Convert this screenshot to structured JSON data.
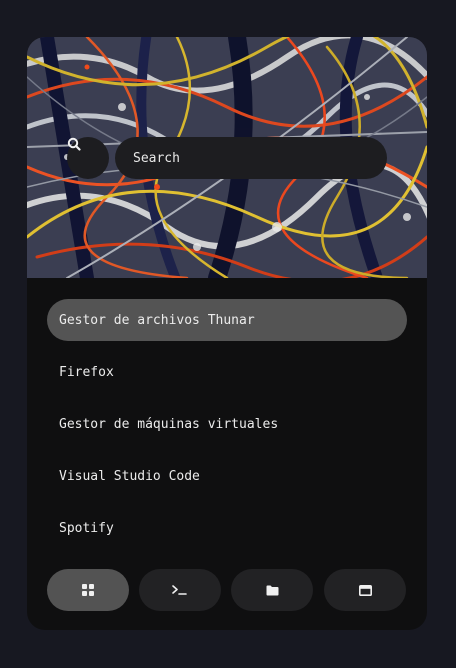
{
  "search": {
    "placeholder": "Search",
    "icon": "search-icon"
  },
  "apps": [
    {
      "label": "Gestor de archivos Thunar",
      "selected": true
    },
    {
      "label": "Firefox",
      "selected": false
    },
    {
      "label": "Gestor de máquinas virtuales",
      "selected": false
    },
    {
      "label": "Visual Studio Code",
      "selected": false
    },
    {
      "label": "Spotify",
      "selected": false
    }
  ],
  "dock": [
    {
      "icon": "grid-icon",
      "active": true
    },
    {
      "icon": "terminal-icon",
      "active": false
    },
    {
      "icon": "folder-icon",
      "active": false
    },
    {
      "icon": "window-icon",
      "active": false
    }
  ],
  "colors": {
    "background": "#171821",
    "panel": "#0f0f10",
    "selected": "#545454",
    "button": "#222224"
  }
}
